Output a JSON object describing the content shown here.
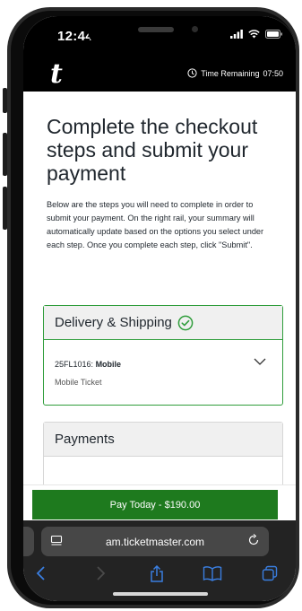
{
  "status_bar": {
    "time": "12:44"
  },
  "header": {
    "logo": "t",
    "timer_label": "Time Remaining",
    "timer_value": "07:50"
  },
  "page": {
    "title": "Complete the checkout steps and submit your payment",
    "description": "Below are the steps you will need to complete in order to submit your payment. On the right rail, your summary will automatically update based on the options you select under each step. Once you complete each step, click \"Submit\"."
  },
  "delivery": {
    "title": "Delivery & Shipping",
    "code": "25FL1016:",
    "method": "Mobile",
    "subtitle": "Mobile Ticket"
  },
  "payments": {
    "title": "Payments"
  },
  "pay_button": {
    "label": "Pay Today - $190.00"
  },
  "browser": {
    "url": "am.ticketmaster.com"
  },
  "colors": {
    "accent_green": "#1e7a1e",
    "check_green": "#2f9d3b",
    "header_black": "#000000"
  },
  "icons": [
    "clock-icon",
    "check-circle-icon",
    "chevron-down-icon",
    "reader-icon",
    "reload-icon",
    "back-icon",
    "forward-icon",
    "share-icon",
    "bookmarks-icon",
    "tabs-icon",
    "signal-icon",
    "wifi-icon",
    "battery-icon"
  ]
}
